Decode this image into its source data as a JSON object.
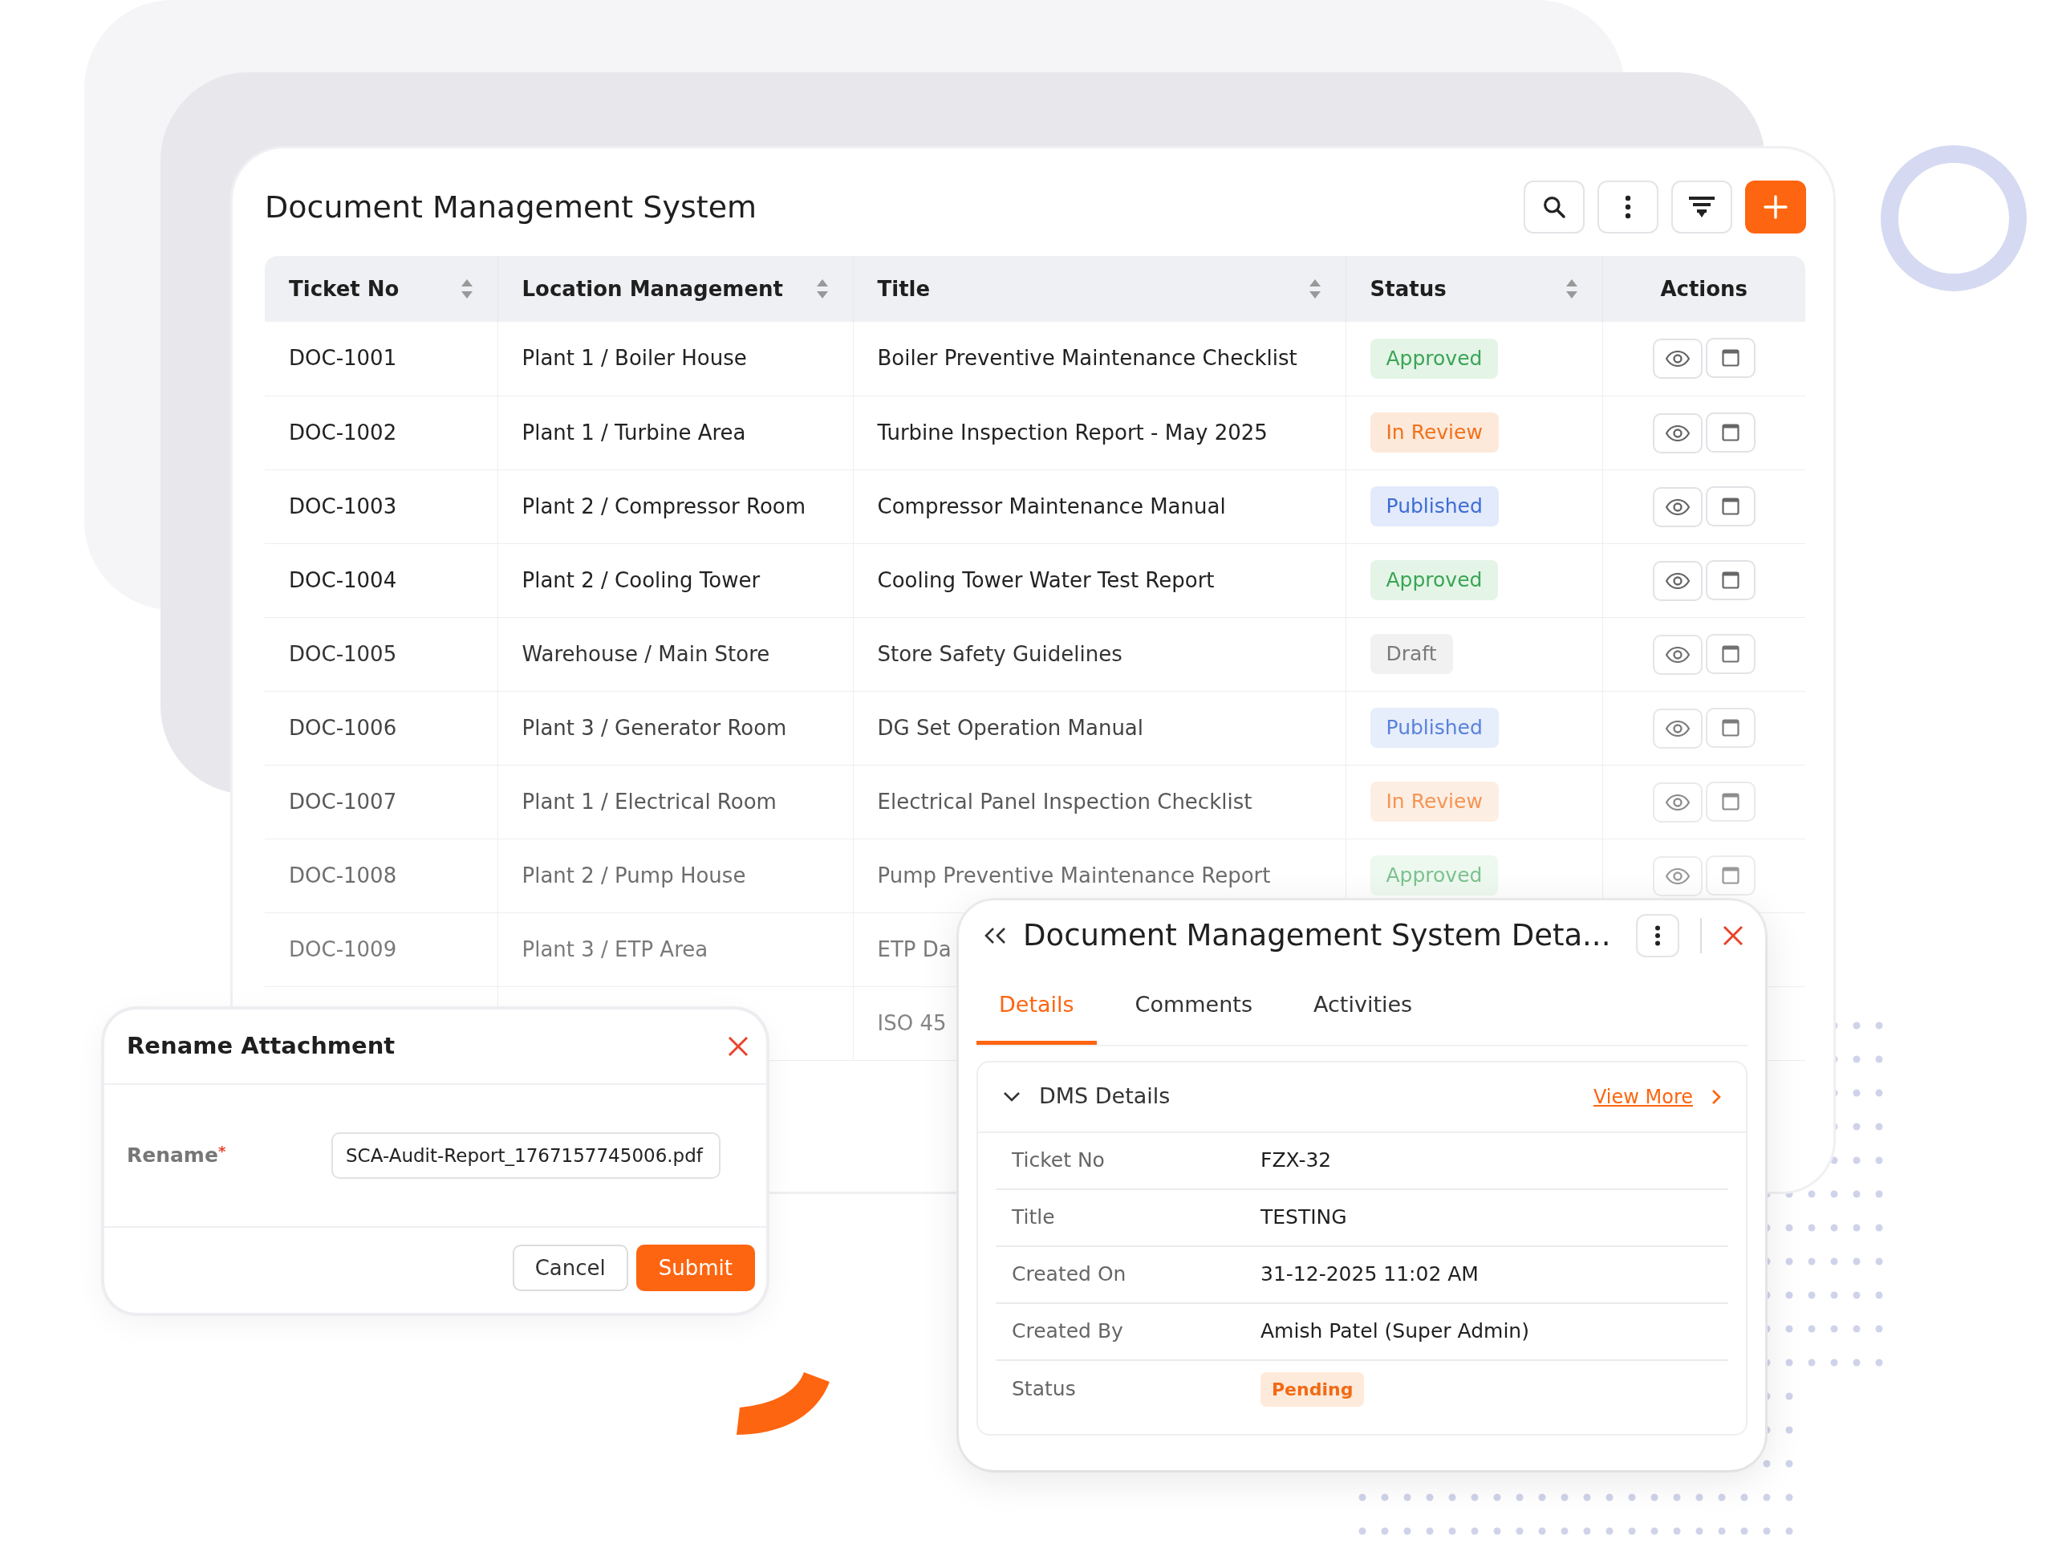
{
  "main": {
    "title": "Document Management System",
    "columns": [
      {
        "label": "Ticket No",
        "sortable": true
      },
      {
        "label": "Location Management",
        "sortable": true
      },
      {
        "label": "Title",
        "sortable": true
      },
      {
        "label": "Status",
        "sortable": true
      },
      {
        "label": "Actions",
        "sortable": false
      }
    ],
    "rows": [
      {
        "ticket": "DOC-1001",
        "location": "Plant 1 / Boiler House",
        "title": "Boiler Preventive Maintenance Checklist",
        "status": {
          "label": "Approved",
          "kind": "approved"
        }
      },
      {
        "ticket": "DOC-1002",
        "location": "Plant 1 / Turbine Area",
        "title": "Turbine Inspection Report - May 2025",
        "status": {
          "label": "In Review",
          "kind": "review"
        }
      },
      {
        "ticket": "DOC-1003",
        "location": "Plant 2 / Compressor Room",
        "title": "Compressor Maintenance Manual",
        "status": {
          "label": "Published",
          "kind": "published"
        }
      },
      {
        "ticket": "DOC-1004",
        "location": "Plant 2 / Cooling Tower",
        "title": "Cooling Tower Water Test Report",
        "status": {
          "label": "Approved",
          "kind": "approved"
        }
      },
      {
        "ticket": "DOC-1005",
        "location": "Warehouse / Main Store",
        "title": "Store Safety Guidelines",
        "status": {
          "label": "Draft",
          "kind": "draft"
        }
      },
      {
        "ticket": "DOC-1006",
        "location": "Plant 3 / Generator Room",
        "title": "DG Set Operation Manual",
        "status": {
          "label": "Published",
          "kind": "published"
        }
      },
      {
        "ticket": "DOC-1007",
        "location": "Plant 1 / Electrical Room",
        "title": "Electrical Panel Inspection Checklist",
        "status": {
          "label": "In Review",
          "kind": "review"
        }
      },
      {
        "ticket": "DOC-1008",
        "location": "Plant 2 / Pump House",
        "title": "Pump Preventive Maintenance Report",
        "status": {
          "label": "Approved",
          "kind": "approved"
        }
      },
      {
        "ticket": "DOC-1009",
        "location": "Plant 3 / ETP Area",
        "title": "ETP Da"
      },
      {
        "title": "ISO 45"
      }
    ]
  },
  "details": {
    "title": "Document Management System Deta...",
    "tabs": [
      {
        "label": "Details",
        "selected": true
      },
      {
        "label": "Comments",
        "selected": false
      },
      {
        "label": "Activities",
        "selected": false
      }
    ],
    "section": {
      "title": "DMS Details",
      "expanded": true,
      "link": "View More"
    },
    "fields": [
      {
        "label": "Ticket No",
        "value": "FZX-32"
      },
      {
        "label": "Title",
        "value": "TESTING"
      },
      {
        "label": "Created On",
        "value": "31-12-2025 11:02 AM"
      },
      {
        "label": "Created By",
        "value": "Amish Patel (Super Admin)"
      },
      {
        "label": "Status",
        "badge": "Pending"
      }
    ]
  },
  "rename": {
    "title": "Rename Attachment",
    "label": "Rename",
    "required_mark": "*",
    "value": "SCA-Audit-Report_1767157745006.pdf",
    "buttons": [
      {
        "label": "Cancel",
        "kind": "secondary"
      },
      {
        "label": "Submit",
        "kind": "primary"
      }
    ]
  }
}
